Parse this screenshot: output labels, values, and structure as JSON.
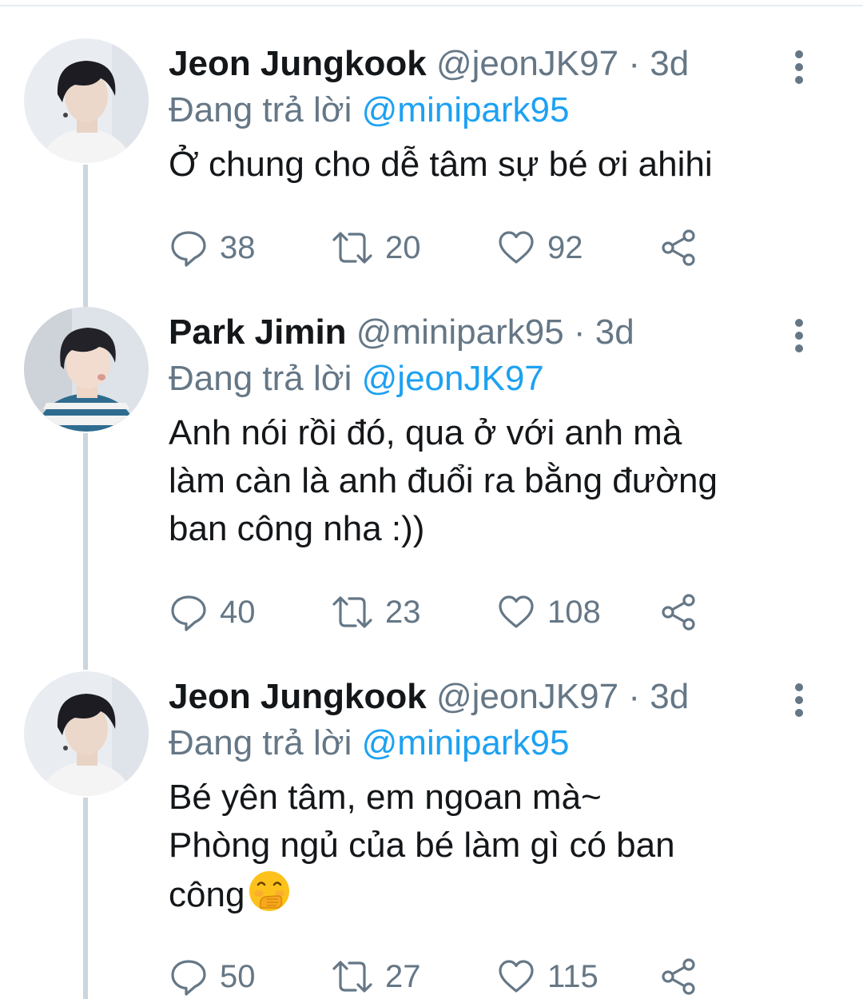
{
  "tweets": [
    {
      "name": "Jeon Jungkook",
      "handle": "@jeonJK97",
      "dot": "·",
      "time": "3d",
      "reply_prefix": "Đang trả lời",
      "reply_to": "@minipark95",
      "text_lines": [
        "Ở chung cho dễ tâm sự bé ơi ahihi"
      ],
      "replies": "38",
      "retweets": "20",
      "likes": "92"
    },
    {
      "name": "Park Jimin",
      "handle": "@minipark95",
      "dot": "·",
      "time": "3d",
      "reply_prefix": "Đang trả lời",
      "reply_to": "@jeonJK97",
      "text_lines": [
        "Anh nói rồi đó, qua ở với anh mà",
        "làm càn là anh đuổi ra bằng đường",
        "ban công nha :))"
      ],
      "replies": "40",
      "retweets": "23",
      "likes": "108"
    },
    {
      "name": "Jeon Jungkook",
      "handle": "@jeonJK97",
      "dot": "·",
      "time": "3d",
      "reply_prefix": "Đang trả lời",
      "reply_to": "@minipark95",
      "text_lines": [
        "Bé yên tâm, em ngoan mà~",
        "Phòng ngủ của bé làm gì có ban",
        "công"
      ],
      "replies": "50",
      "retweets": "27",
      "likes": "115"
    }
  ],
  "icons": {
    "reply": "speech-bubble-icon",
    "retweet": "retweet-icon",
    "like": "heart-icon",
    "share": "share-icon",
    "more": "more-vertical-icon",
    "emoji": "face-with-hand-over-mouth-emoji"
  },
  "colors": {
    "text": "#14171a",
    "secondary": "#657786",
    "link": "#1da1f2",
    "thread_line": "#ccd6dd"
  }
}
